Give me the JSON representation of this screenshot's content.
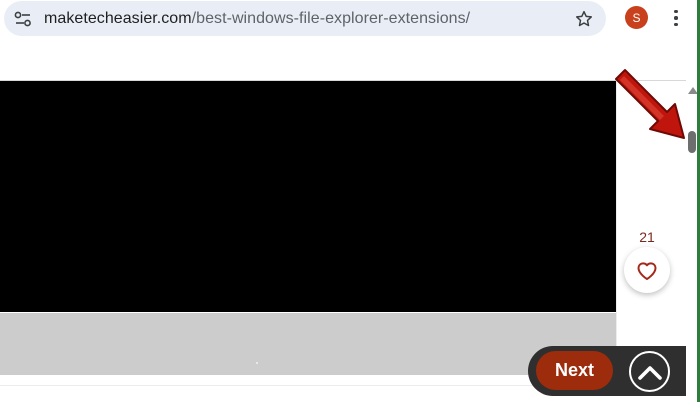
{
  "browser": {
    "url_domain": "maketecheasier.com",
    "url_path": "/best-windows-file-explorer-extensions/",
    "site_info_icon": "tune-icon",
    "bookmark_icon": "star-outline-icon",
    "profile_initial": "S",
    "menu_icon": "kebab-menu-icon"
  },
  "article": {
    "like_count": "21",
    "like_icon": "heart-outline-icon"
  },
  "nav": {
    "next_label": "Next",
    "scroll_top_icon": "chevron-up-icon"
  },
  "colors": {
    "next_button": "#9c2c0c",
    "avatar": "#c8401c",
    "annotation_arrow": "#c0150c",
    "like_heart": "#a32a1a"
  }
}
